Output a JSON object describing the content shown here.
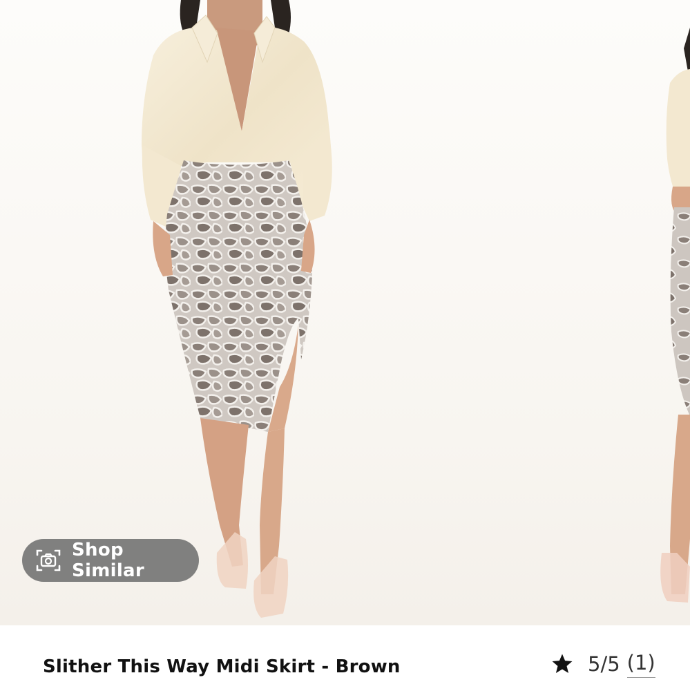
{
  "gallery": {
    "images": [
      {
        "alt": "model-front-view"
      },
      {
        "alt": "model-side-view"
      }
    ],
    "shop_similar": {
      "label": "Shop Similar",
      "icon": "camera-scan-icon"
    }
  },
  "product": {
    "title": "Slither This Way Midi Skirt - Brown",
    "rating": {
      "icon": "star-icon",
      "score": "5/5",
      "count": "(1)"
    }
  },
  "colors": {
    "pill_bg": "#707070",
    "text": "#111111",
    "background": "#ffffff"
  }
}
